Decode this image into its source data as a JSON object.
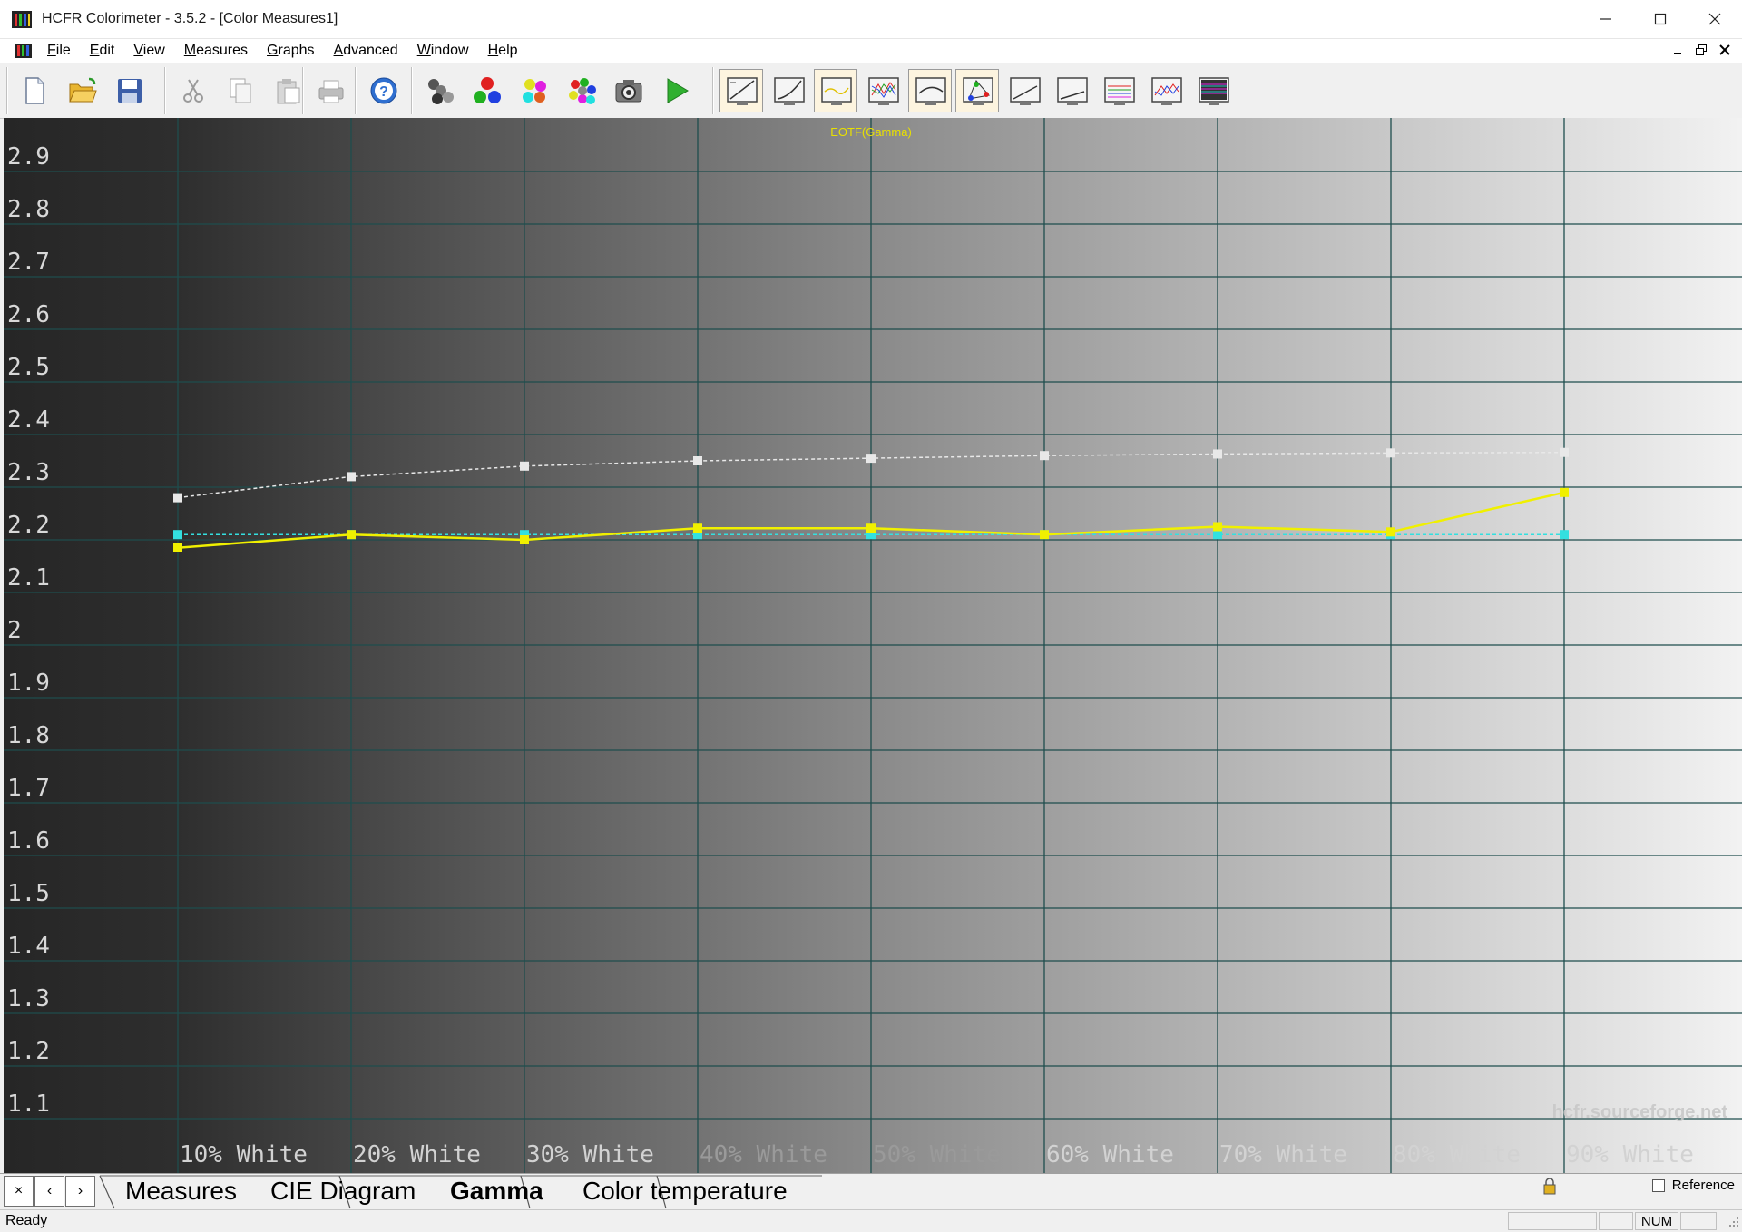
{
  "window": {
    "title": "HCFR Colorimeter - 3.5.2 - [Color Measures1]"
  },
  "menu": [
    "File",
    "Edit",
    "View",
    "Measures",
    "Graphs",
    "Advanced",
    "Window",
    "Help"
  ],
  "toolbar": {
    "groups": [
      [
        "new-document-icon",
        "open-folder-icon",
        "save-disk-icon"
      ],
      [
        "cut-icon",
        "copy-icon",
        "paste-icon"
      ],
      [
        "print-icon"
      ],
      [
        "help-icon"
      ],
      [
        "grayscale-measure-icon",
        "primaries-measure-icon",
        "secondaries-measure-icon",
        "all-colors-measure-icon",
        "camera-icon",
        "play-icon"
      ],
      [
        "luminance-graph-icon",
        "gamma-graph-icon",
        "eotf-graph-icon",
        "rgb-levels-graph-icon",
        "color-temp-graph-icon",
        "cie-chart-icon",
        "saturation-graph-icon",
        "near-black-graph-icon",
        "deltae-graph-icon",
        "color-comparator-icon",
        "measures-grid-icon"
      ]
    ],
    "pressed": [
      "luminance-graph-icon",
      "eotf-graph-icon",
      "color-temp-graph-icon",
      "cie-chart-icon"
    ]
  },
  "chart_data": {
    "type": "line",
    "title": "EOTF(Gamma)",
    "categories": [
      "10% White",
      "20% White",
      "30% White",
      "40% White",
      "50% White",
      "60% White",
      "70% White",
      "80% White",
      "90% White"
    ],
    "ylim": [
      1.0,
      3.0
    ],
    "yticks": [
      2.9,
      2.8,
      2.7,
      2.6,
      2.5,
      2.4,
      2.3,
      2.2,
      2.1,
      2,
      1.9,
      1.8,
      1.7,
      1.6,
      1.5,
      1.4,
      1.3,
      1.2,
      1.1
    ],
    "grid": true,
    "watermark": "hcfr.sourceforge.net",
    "series": [
      {
        "color": "#e8e8e8",
        "style": "dashed",
        "values": [
          2.28,
          2.32,
          2.34,
          2.35,
          2.355,
          2.36,
          2.363,
          2.365,
          2.366
        ]
      },
      {
        "color": "#33e0e0",
        "style": "dashed",
        "values": [
          2.21,
          2.21,
          2.21,
          2.21,
          2.21,
          2.21,
          2.21,
          2.21,
          2.21
        ]
      },
      {
        "color": "#f0f000",
        "style": "solid",
        "values": [
          2.185,
          2.21,
          2.2,
          2.222,
          2.222,
          2.21,
          2.225,
          2.215,
          2.29
        ]
      }
    ]
  },
  "tabs": {
    "nav": [
      "×",
      "‹",
      "›"
    ],
    "items": [
      "Measures",
      "CIE Diagram",
      "Gamma",
      "Color temperature"
    ],
    "active": "Gamma",
    "reference_label": "Reference"
  },
  "status": {
    "ready": "Ready",
    "num": "NUM"
  }
}
